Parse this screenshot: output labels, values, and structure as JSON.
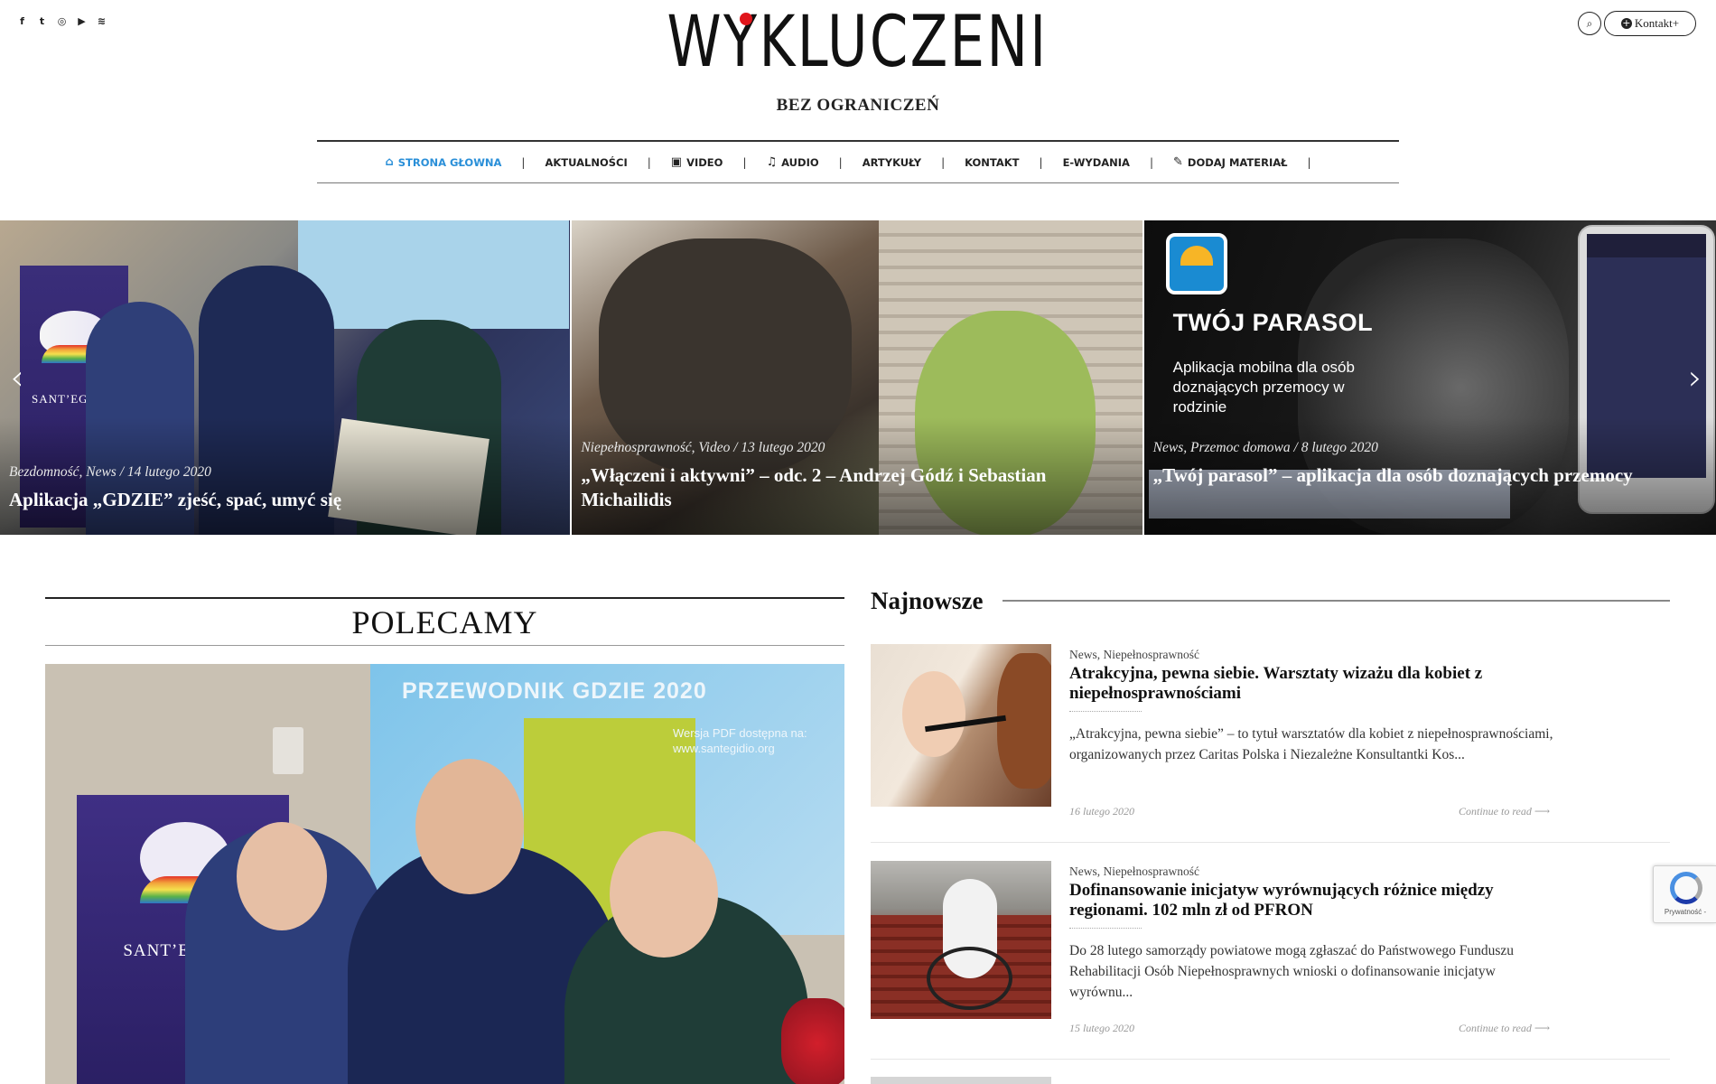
{
  "social": [
    {
      "icon": "facebook-icon",
      "glyph": "f"
    },
    {
      "icon": "twitter-icon",
      "glyph": "t"
    },
    {
      "icon": "instagram-icon",
      "glyph": "◎"
    },
    {
      "icon": "youtube-icon",
      "glyph": "▶"
    },
    {
      "icon": "rss-icon",
      "glyph": "≋"
    }
  ],
  "site": {
    "title": "WYKLUCZENI",
    "tagline": "BEZ OGRANICZEŃ",
    "accent_color": "#2a8fd8",
    "logo_dot_color": "#e0151b"
  },
  "header": {
    "search_icon": "⌕",
    "kontakt_label": "Kontakt+",
    "kontakt_icon": "+"
  },
  "nav": [
    {
      "label": "STRONA GŁOWNA",
      "icon": "⌂",
      "active": true
    },
    {
      "label": "AKTUALNOŚCI",
      "icon": ""
    },
    {
      "label": "VIDEO",
      "icon": "▣"
    },
    {
      "label": "AUDIO",
      "icon": "♫"
    },
    {
      "label": "ARTYKUŁY",
      "icon": ""
    },
    {
      "label": "KONTAKT",
      "icon": ""
    },
    {
      "label": "E-WYDANIA",
      "icon": ""
    },
    {
      "label": "DODAJ MATERIAŁ",
      "icon": "✎"
    }
  ],
  "slider": {
    "prev": "‹",
    "next": "›",
    "slides": [
      {
        "meta": "Bezdomność, News / 14 lutego 2020",
        "title": "Aplikacja „GDZIE” zjeść, spać, umyć się",
        "banner": "SANT’EGIDIO"
      },
      {
        "meta": "Niepełnosprawność, Video / 13 lutego 2020",
        "title": "„Włączeni i aktywni” – odc. 2 – Andrzej Gódź i Sebastian Michailidis"
      },
      {
        "meta": "News, Przemoc domowa / 8 lutego 2020",
        "title": "„Twój parasol” – aplikacja dla osób doznających przemocy",
        "promo_title": "TWÓJ PARASOL",
        "promo_desc": "Aplikacja mobilna dla osób doznających  przemocy w rodzinie"
      }
    ]
  },
  "polecamy": {
    "heading": "POLECAMY",
    "image_title": "PRZEWODNIK GDZIE 2020",
    "image_pdf": "Wersja PDF dostępna na: www.santegidio.org",
    "banner": "SANT’EGIDIO"
  },
  "najnowsze": {
    "heading": "Najnowsze",
    "posts": [
      {
        "cats": "News, Niepełnosprawność",
        "title": "Atrakcyjna, pewna siebie. Warsztaty wizażu dla kobiet z niepełnosprawnościami",
        "excerpt": "„Atrakcyjna, pewna siebie” – to tytuł warsztatów dla kobiet z niepełnosprawnościami, organizowanych przez Caritas Polska i Niezależne Konsultantki Kos...",
        "date": "16 lutego 2020",
        "more": "Continue to read ⟶"
      },
      {
        "cats": "News, Niepełnosprawność",
        "title": "Dofinansowanie inicjatyw wyrównujących różnice między regionami. 102 mln zł od PFRON",
        "excerpt": "Do 28 lutego samorządy powiatowe mogą zgłaszać do Państwowego Funduszu Rehabilitacji Osób Niepełnosprawnych wnioski o dofinansowanie inicjatyw wyrównu...",
        "date": "15 lutego 2020",
        "more": "Continue to read ⟶"
      }
    ]
  },
  "recaptcha": {
    "text": "Prywatność -"
  }
}
